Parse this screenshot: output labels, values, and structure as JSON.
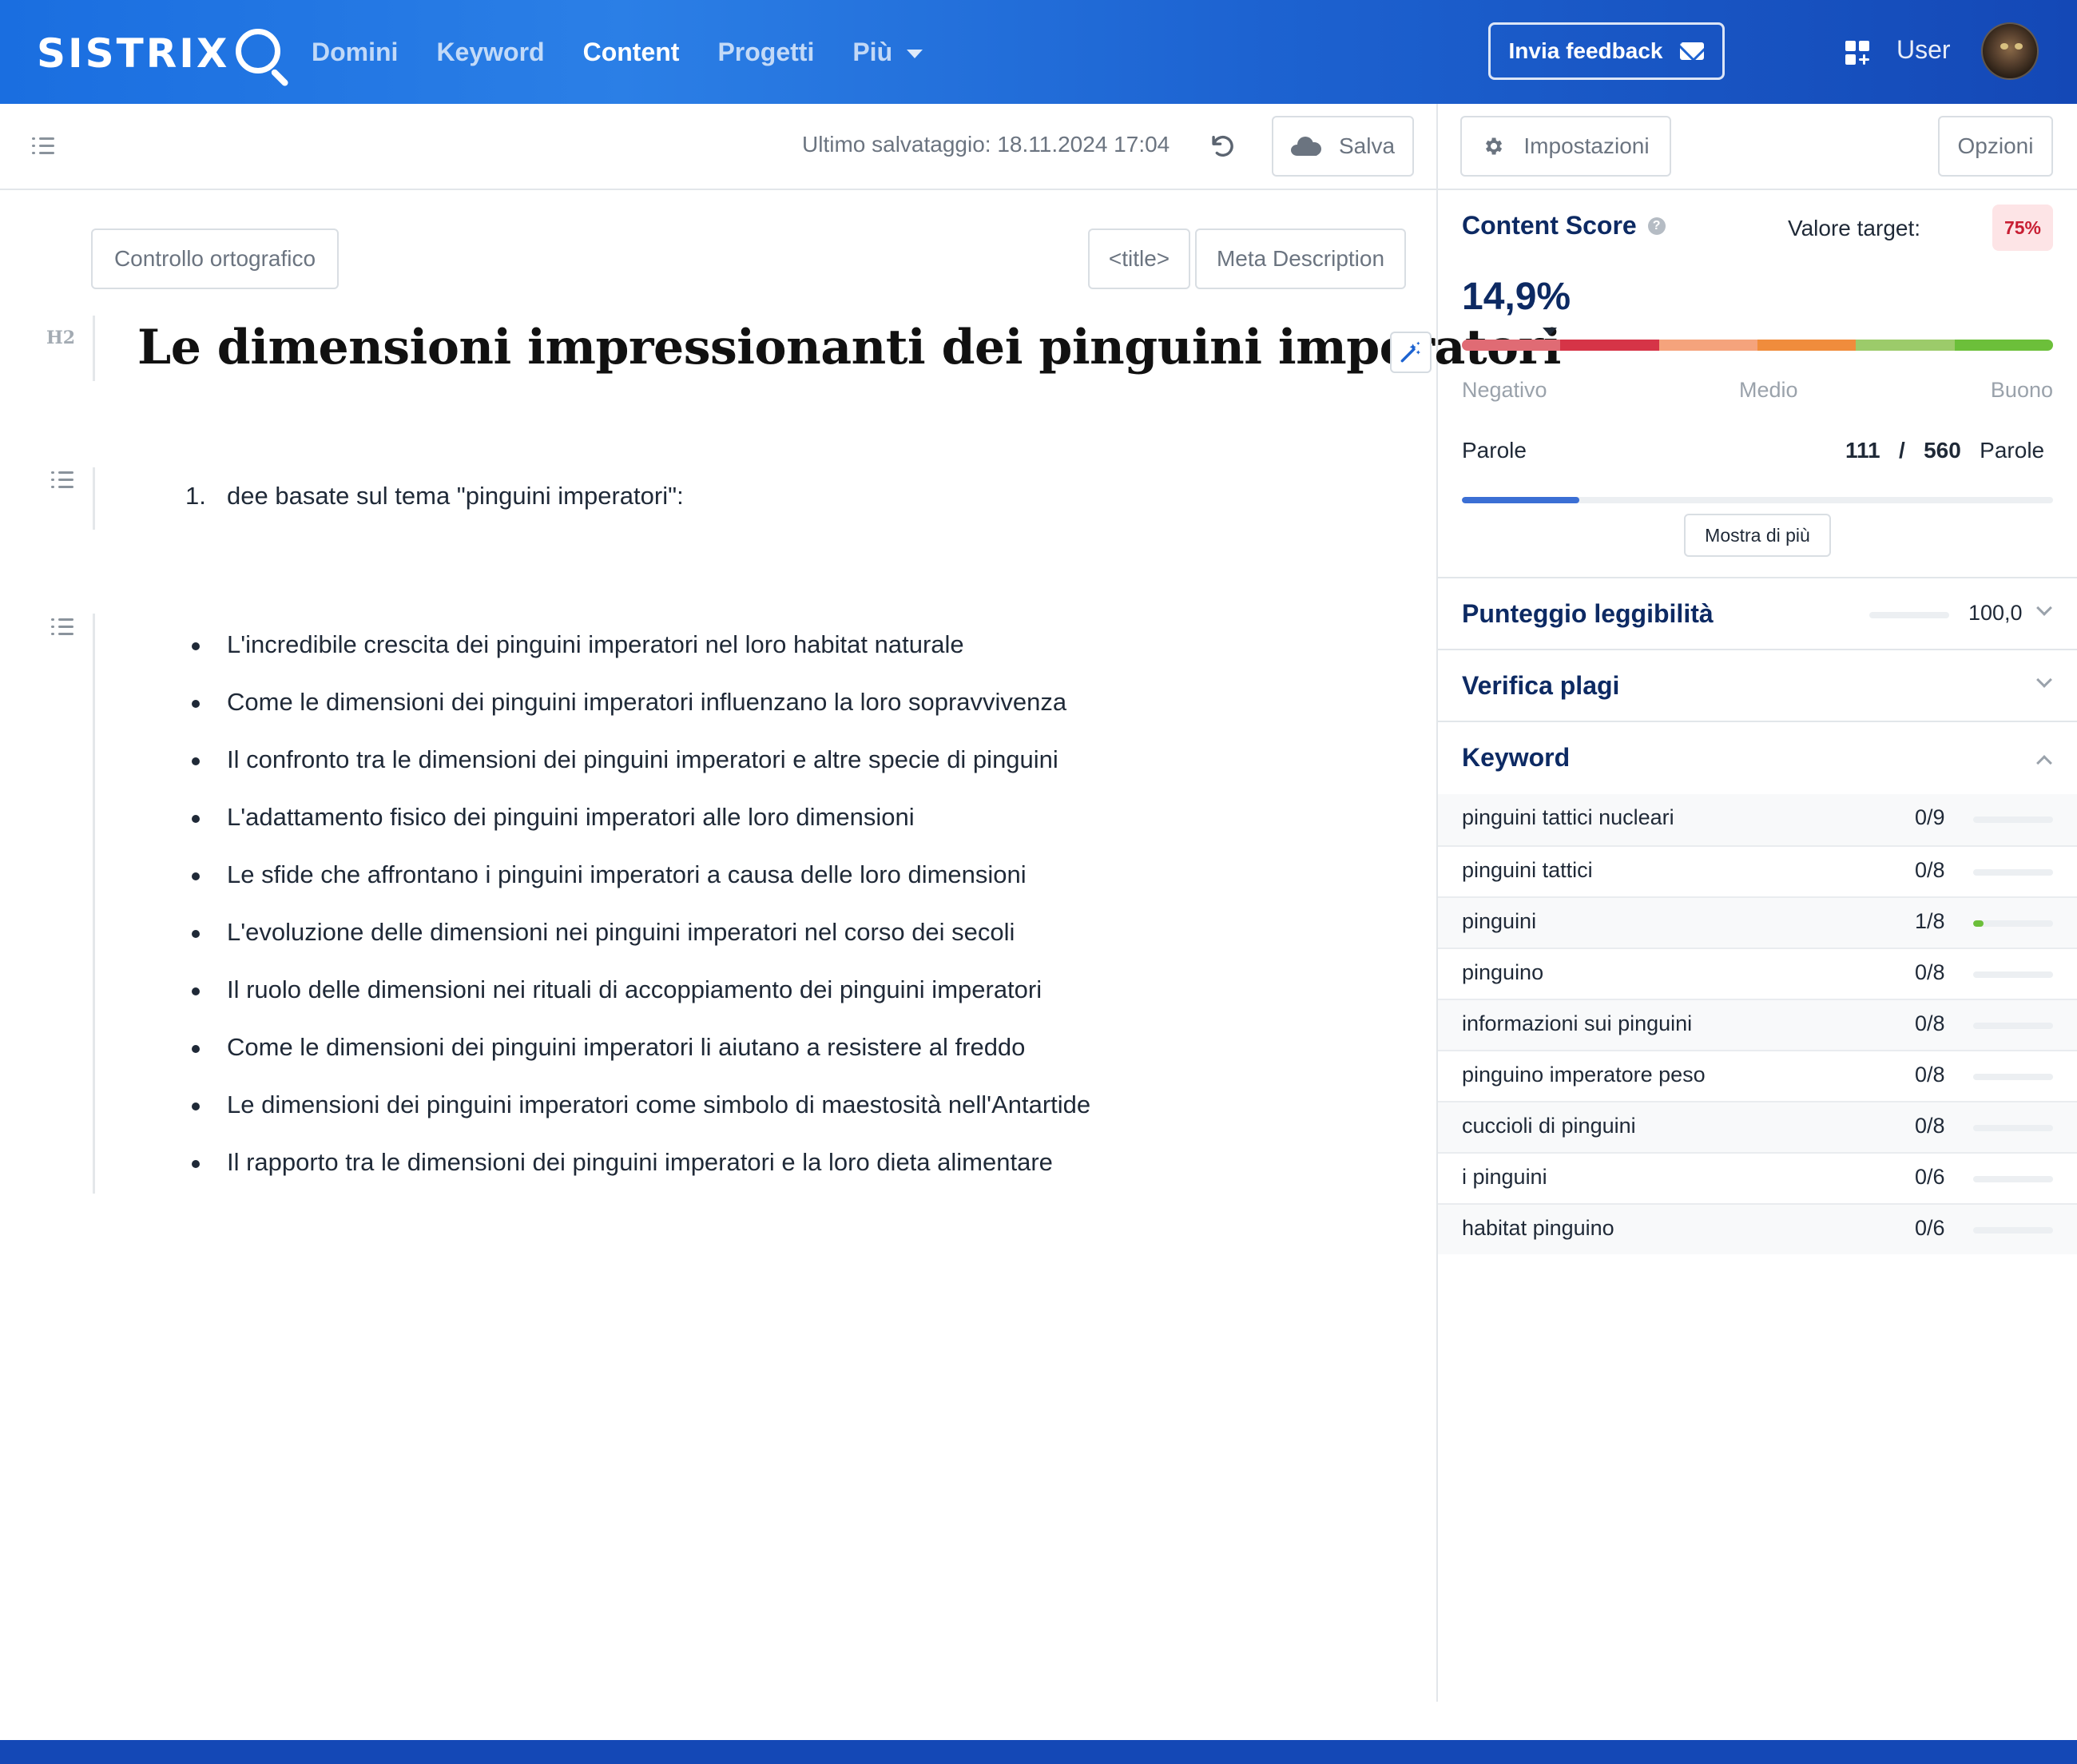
{
  "nav": {
    "logo_text": "SISTRIX",
    "items": [
      "Domini",
      "Keyword",
      "Content",
      "Progetti",
      "Più"
    ],
    "active_item": "Content",
    "feedback_label": "Invia feedback",
    "user_label": "User"
  },
  "toolbar": {
    "last_save": "Ultimo salvataggio: 18.11.2024 17:04",
    "save_label": "Salva",
    "settings_label": "Impostazioni",
    "options_label": "Opzioni"
  },
  "editor": {
    "spellcheck_label": "Controllo ortografico",
    "title_tag_label": "<title>",
    "meta_label": "Meta Description",
    "heading_tag": "H2",
    "heading": "Le dimensioni impressionanti dei pinguini imperatori",
    "ordered_item_number": "1.",
    "ordered_item": "dee basate sul tema \"pinguini imperatori\":",
    "bullets": [
      "L'incredibile crescita dei pinguini imperatori nel loro habitat naturale",
      "Come le dimensioni dei pinguini imperatori influenzano la loro sopravvivenza",
      "Il confronto tra le dimensioni dei pinguini imperatori e altre specie di pinguini",
      "L'adattamento fisico dei pinguini imperatori alle loro dimensioni",
      "Le sfide che affrontano i pinguini imperatori a causa delle loro dimensioni",
      "L'evoluzione delle dimensioni nei pinguini imperatori nel corso dei secoli",
      "Il ruolo delle dimensioni nei rituali di accoppiamento dei pinguini imperatori",
      "Come le dimensioni dei pinguini imperatori li aiutano a resistere al freddo",
      "Le dimensioni dei pinguini imperatori come simbolo di maestosità nell'Antartide",
      "Il rapporto tra le dimensioni dei pinguini imperatori e la loro dieta alimentare"
    ]
  },
  "panel": {
    "content_score_title": "Content Score",
    "help_glyph": "?",
    "target_label": "Valore target:",
    "target_value": "75%",
    "score_value": "14,9%",
    "score_fraction": 0.149,
    "scale": {
      "negative": "Negativo",
      "medium": "Medio",
      "good": "Buono"
    },
    "words_label": "Parole",
    "words_current": "111",
    "words_separator": "/",
    "words_target": "560",
    "words_unit": "Parole",
    "words_fraction": 0.198,
    "show_more_label": "Mostra di più",
    "readability_title": "Punteggio leggibilità",
    "readability_value": "100,0",
    "plagiarism_title": "Verifica plagi",
    "keyword_title": "Keyword",
    "keywords": [
      {
        "label": "pinguini tattici nucleari",
        "count": "0/9",
        "fraction": 0
      },
      {
        "label": "pinguini tattici",
        "count": "0/8",
        "fraction": 0
      },
      {
        "label": "pinguini",
        "count": "1/8",
        "fraction": 0.125
      },
      {
        "label": "pinguino",
        "count": "0/8",
        "fraction": 0
      },
      {
        "label": "informazioni sui pinguini",
        "count": "0/8",
        "fraction": 0
      },
      {
        "label": "pinguino imperatore peso",
        "count": "0/8",
        "fraction": 0
      },
      {
        "label": "cuccioli di pinguini",
        "count": "0/8",
        "fraction": 0
      },
      {
        "label": "i pinguini",
        "count": "0/6",
        "fraction": 0
      },
      {
        "label": "habitat pinguino",
        "count": "0/6",
        "fraction": 0
      }
    ]
  },
  "colors": {
    "brand_blue": "#1d63d1",
    "title_navy": "#0d2a63",
    "score_scale": [
      "#e06b74",
      "#d63447",
      "#f5a37c",
      "#f08c3c",
      "#9ccb6a",
      "#6cbf3a"
    ],
    "progress_blue": "#3b6fd4",
    "keyword_green": "#6cbf3a",
    "target_red": "#c81e33"
  }
}
